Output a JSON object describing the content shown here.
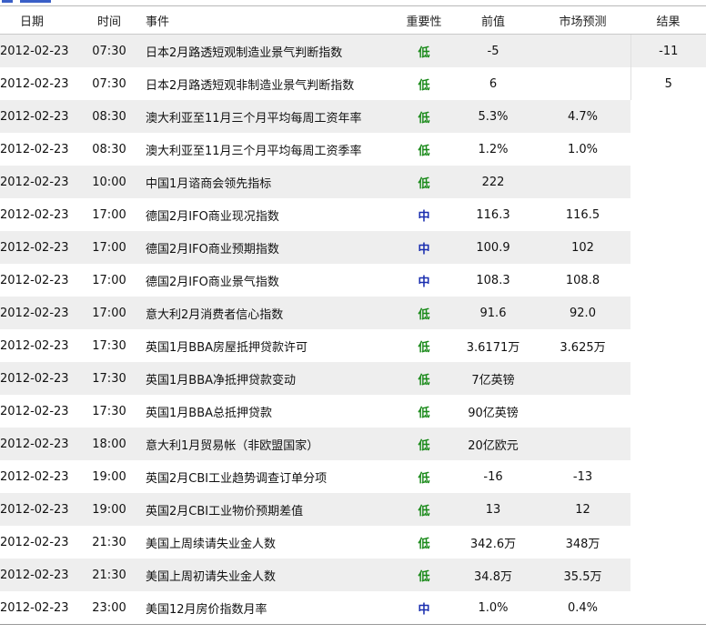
{
  "headers": {
    "date": "日期",
    "time": "时间",
    "event": "事件",
    "importance": "重要性",
    "previous": "前值",
    "forecast": "市场预测",
    "result": "结果"
  },
  "colors": {
    "low": "#1a8a1a",
    "mid": "#1b2fb0",
    "row_shade": "#eeeeee"
  },
  "rows": [
    {
      "date": "2012-02-23",
      "time": "07:30",
      "event": "日本2月路透短观制造业景气判断指数",
      "importance": "低",
      "level": "low",
      "previous": "-5",
      "forecast": "",
      "result": "-11",
      "shaded": true
    },
    {
      "date": "2012-02-23",
      "time": "07:30",
      "event": "日本2月路透短观非制造业景气判断指数",
      "importance": "低",
      "level": "low",
      "previous": "6",
      "forecast": "",
      "result": "5",
      "shaded": false
    },
    {
      "date": "2012-02-23",
      "time": "08:30",
      "event": "澳大利亚至11月三个月平均每周工资年率",
      "importance": "低",
      "level": "low",
      "previous": "5.3%",
      "forecast": "4.7%",
      "result": "",
      "shaded": true
    },
    {
      "date": "2012-02-23",
      "time": "08:30",
      "event": "澳大利亚至11月三个月平均每周工资季率",
      "importance": "低",
      "level": "low",
      "previous": "1.2%",
      "forecast": "1.0%",
      "result": "",
      "shaded": false
    },
    {
      "date": "2012-02-23",
      "time": "10:00",
      "event": "中国1月谘商会领先指标",
      "importance": "低",
      "level": "low",
      "previous": "222",
      "forecast": "",
      "result": "",
      "shaded": true
    },
    {
      "date": "2012-02-23",
      "time": "17:00",
      "event": "德国2月IFO商业现况指数",
      "importance": "中",
      "level": "mid",
      "previous": "116.3",
      "forecast": "116.5",
      "result": "",
      "shaded": false
    },
    {
      "date": "2012-02-23",
      "time": "17:00",
      "event": "德国2月IFO商业预期指数",
      "importance": "中",
      "level": "mid",
      "previous": "100.9",
      "forecast": "102",
      "result": "",
      "shaded": true
    },
    {
      "date": "2012-02-23",
      "time": "17:00",
      "event": "德国2月IFO商业景气指数",
      "importance": "中",
      "level": "mid",
      "previous": "108.3",
      "forecast": "108.8",
      "result": "",
      "shaded": false
    },
    {
      "date": "2012-02-23",
      "time": "17:00",
      "event": "意大利2月消费者信心指数",
      "importance": "低",
      "level": "low",
      "previous": "91.6",
      "forecast": "92.0",
      "result": "",
      "shaded": true
    },
    {
      "date": "2012-02-23",
      "time": "17:30",
      "event": "英国1月BBA房屋抵押贷款许可",
      "importance": "低",
      "level": "low",
      "previous": "3.6171万",
      "forecast": "3.625万",
      "result": "",
      "shaded": false
    },
    {
      "date": "2012-02-23",
      "time": "17:30",
      "event": "英国1月BBA净抵押贷款变动",
      "importance": "低",
      "level": "low",
      "previous": "7亿英镑",
      "forecast": "",
      "result": "",
      "shaded": true
    },
    {
      "date": "2012-02-23",
      "time": "17:30",
      "event": "英国1月BBA总抵押贷款",
      "importance": "低",
      "level": "low",
      "previous": "90亿英镑",
      "forecast": "",
      "result": "",
      "shaded": false
    },
    {
      "date": "2012-02-23",
      "time": "18:00",
      "event": "意大利1月贸易帐（非欧盟国家）",
      "importance": "低",
      "level": "low",
      "previous": "20亿欧元",
      "forecast": "",
      "result": "",
      "shaded": true
    },
    {
      "date": "2012-02-23",
      "time": "19:00",
      "event": "英国2月CBI工业趋势调查订单分项",
      "importance": "低",
      "level": "low",
      "previous": "-16",
      "forecast": "-13",
      "result": "",
      "shaded": false
    },
    {
      "date": "2012-02-23",
      "time": "19:00",
      "event": "英国2月CBI工业物价预期差值",
      "importance": "低",
      "level": "low",
      "previous": "13",
      "forecast": "12",
      "result": "",
      "shaded": true
    },
    {
      "date": "2012-02-23",
      "time": "21:30",
      "event": "美国上周续请失业金人数",
      "importance": "低",
      "level": "low",
      "previous": "342.6万",
      "forecast": "348万",
      "result": "",
      "shaded": false
    },
    {
      "date": "2012-02-23",
      "time": "21:30",
      "event": "美国上周初请失业金人数",
      "importance": "低",
      "level": "low",
      "previous": "34.8万",
      "forecast": "35.5万",
      "result": "",
      "shaded": true
    },
    {
      "date": "2012-02-23",
      "time": "23:00",
      "event": "美国12月房价指数月率",
      "importance": "中",
      "level": "mid",
      "previous": "1.0%",
      "forecast": "0.4%",
      "result": "",
      "shaded": false
    }
  ]
}
